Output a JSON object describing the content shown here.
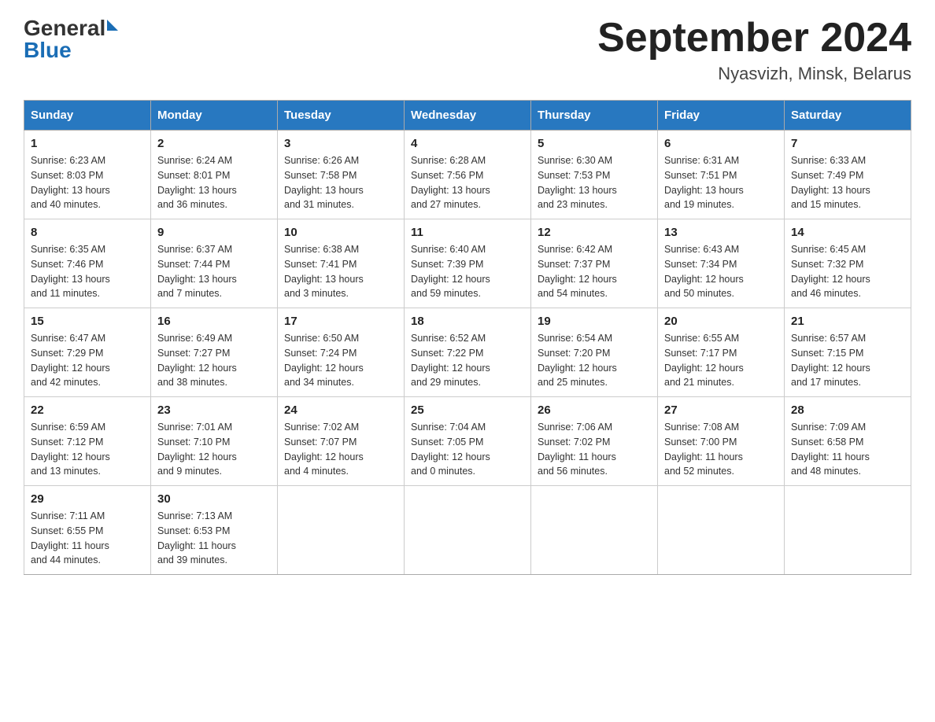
{
  "header": {
    "logo_general": "General",
    "logo_blue": "Blue",
    "month_year": "September 2024",
    "location": "Nyasvizh, Minsk, Belarus"
  },
  "weekdays": [
    "Sunday",
    "Monday",
    "Tuesday",
    "Wednesday",
    "Thursday",
    "Friday",
    "Saturday"
  ],
  "weeks": [
    [
      {
        "day": "1",
        "sunrise": "6:23 AM",
        "sunset": "8:03 PM",
        "daylight": "13 hours and 40 minutes."
      },
      {
        "day": "2",
        "sunrise": "6:24 AM",
        "sunset": "8:01 PM",
        "daylight": "13 hours and 36 minutes."
      },
      {
        "day": "3",
        "sunrise": "6:26 AM",
        "sunset": "7:58 PM",
        "daylight": "13 hours and 31 minutes."
      },
      {
        "day": "4",
        "sunrise": "6:28 AM",
        "sunset": "7:56 PM",
        "daylight": "13 hours and 27 minutes."
      },
      {
        "day": "5",
        "sunrise": "6:30 AM",
        "sunset": "7:53 PM",
        "daylight": "13 hours and 23 minutes."
      },
      {
        "day": "6",
        "sunrise": "6:31 AM",
        "sunset": "7:51 PM",
        "daylight": "13 hours and 19 minutes."
      },
      {
        "day": "7",
        "sunrise": "6:33 AM",
        "sunset": "7:49 PM",
        "daylight": "13 hours and 15 minutes."
      }
    ],
    [
      {
        "day": "8",
        "sunrise": "6:35 AM",
        "sunset": "7:46 PM",
        "daylight": "13 hours and 11 minutes."
      },
      {
        "day": "9",
        "sunrise": "6:37 AM",
        "sunset": "7:44 PM",
        "daylight": "13 hours and 7 minutes."
      },
      {
        "day": "10",
        "sunrise": "6:38 AM",
        "sunset": "7:41 PM",
        "daylight": "13 hours and 3 minutes."
      },
      {
        "day": "11",
        "sunrise": "6:40 AM",
        "sunset": "7:39 PM",
        "daylight": "12 hours and 59 minutes."
      },
      {
        "day": "12",
        "sunrise": "6:42 AM",
        "sunset": "7:37 PM",
        "daylight": "12 hours and 54 minutes."
      },
      {
        "day": "13",
        "sunrise": "6:43 AM",
        "sunset": "7:34 PM",
        "daylight": "12 hours and 50 minutes."
      },
      {
        "day": "14",
        "sunrise": "6:45 AM",
        "sunset": "7:32 PM",
        "daylight": "12 hours and 46 minutes."
      }
    ],
    [
      {
        "day": "15",
        "sunrise": "6:47 AM",
        "sunset": "7:29 PM",
        "daylight": "12 hours and 42 minutes."
      },
      {
        "day": "16",
        "sunrise": "6:49 AM",
        "sunset": "7:27 PM",
        "daylight": "12 hours and 38 minutes."
      },
      {
        "day": "17",
        "sunrise": "6:50 AM",
        "sunset": "7:24 PM",
        "daylight": "12 hours and 34 minutes."
      },
      {
        "day": "18",
        "sunrise": "6:52 AM",
        "sunset": "7:22 PM",
        "daylight": "12 hours and 29 minutes."
      },
      {
        "day": "19",
        "sunrise": "6:54 AM",
        "sunset": "7:20 PM",
        "daylight": "12 hours and 25 minutes."
      },
      {
        "day": "20",
        "sunrise": "6:55 AM",
        "sunset": "7:17 PM",
        "daylight": "12 hours and 21 minutes."
      },
      {
        "day": "21",
        "sunrise": "6:57 AM",
        "sunset": "7:15 PM",
        "daylight": "12 hours and 17 minutes."
      }
    ],
    [
      {
        "day": "22",
        "sunrise": "6:59 AM",
        "sunset": "7:12 PM",
        "daylight": "12 hours and 13 minutes."
      },
      {
        "day": "23",
        "sunrise": "7:01 AM",
        "sunset": "7:10 PM",
        "daylight": "12 hours and 9 minutes."
      },
      {
        "day": "24",
        "sunrise": "7:02 AM",
        "sunset": "7:07 PM",
        "daylight": "12 hours and 4 minutes."
      },
      {
        "day": "25",
        "sunrise": "7:04 AM",
        "sunset": "7:05 PM",
        "daylight": "12 hours and 0 minutes."
      },
      {
        "day": "26",
        "sunrise": "7:06 AM",
        "sunset": "7:02 PM",
        "daylight": "11 hours and 56 minutes."
      },
      {
        "day": "27",
        "sunrise": "7:08 AM",
        "sunset": "7:00 PM",
        "daylight": "11 hours and 52 minutes."
      },
      {
        "day": "28",
        "sunrise": "7:09 AM",
        "sunset": "6:58 PM",
        "daylight": "11 hours and 48 minutes."
      }
    ],
    [
      {
        "day": "29",
        "sunrise": "7:11 AM",
        "sunset": "6:55 PM",
        "daylight": "11 hours and 44 minutes."
      },
      {
        "day": "30",
        "sunrise": "7:13 AM",
        "sunset": "6:53 PM",
        "daylight": "11 hours and 39 minutes."
      },
      null,
      null,
      null,
      null,
      null
    ]
  ]
}
